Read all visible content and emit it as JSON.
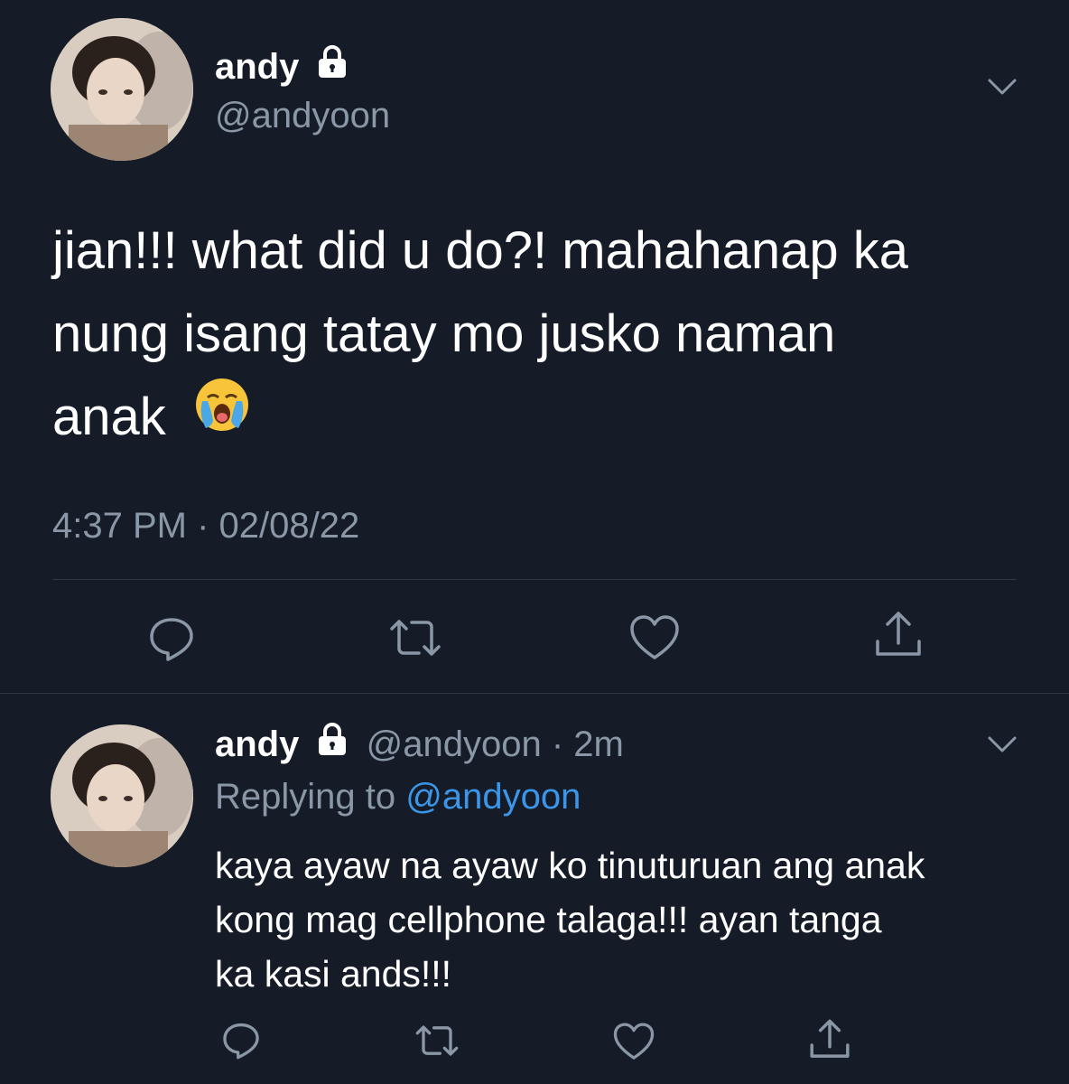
{
  "main_tweet": {
    "author_name": "andy",
    "author_handle": "@andyoon",
    "text_line1": "jian!!! what did u do?! mahahanap ka",
    "text_line2": "nung isang tatay mo jusko naman",
    "text_line3": "anak",
    "emoji": "loudly-crying-face",
    "timestamp": "4:37 PM · 02/08/22",
    "actions": [
      "reply-icon",
      "retweet-icon",
      "like-icon",
      "share-icon"
    ]
  },
  "reply_tweet": {
    "author_name": "andy",
    "author_handle": "@andyoon",
    "time_sep": "·",
    "time": "2m",
    "replying_label": "Replying to",
    "replying_to": "@andyoon",
    "text_line1": "kaya ayaw na ayaw ko tinuturuan ang anak",
    "text_line2": "kong mag cellphone talaga!!! ayan tanga",
    "text_line3": "ka kasi ands!!!",
    "actions": [
      "reply-icon",
      "retweet-icon",
      "like-icon",
      "share-icon"
    ]
  },
  "colors": {
    "background": "#151c27",
    "muted_text": "#8a97a6",
    "link": "#3b95e8",
    "divider": "#2e3846"
  }
}
